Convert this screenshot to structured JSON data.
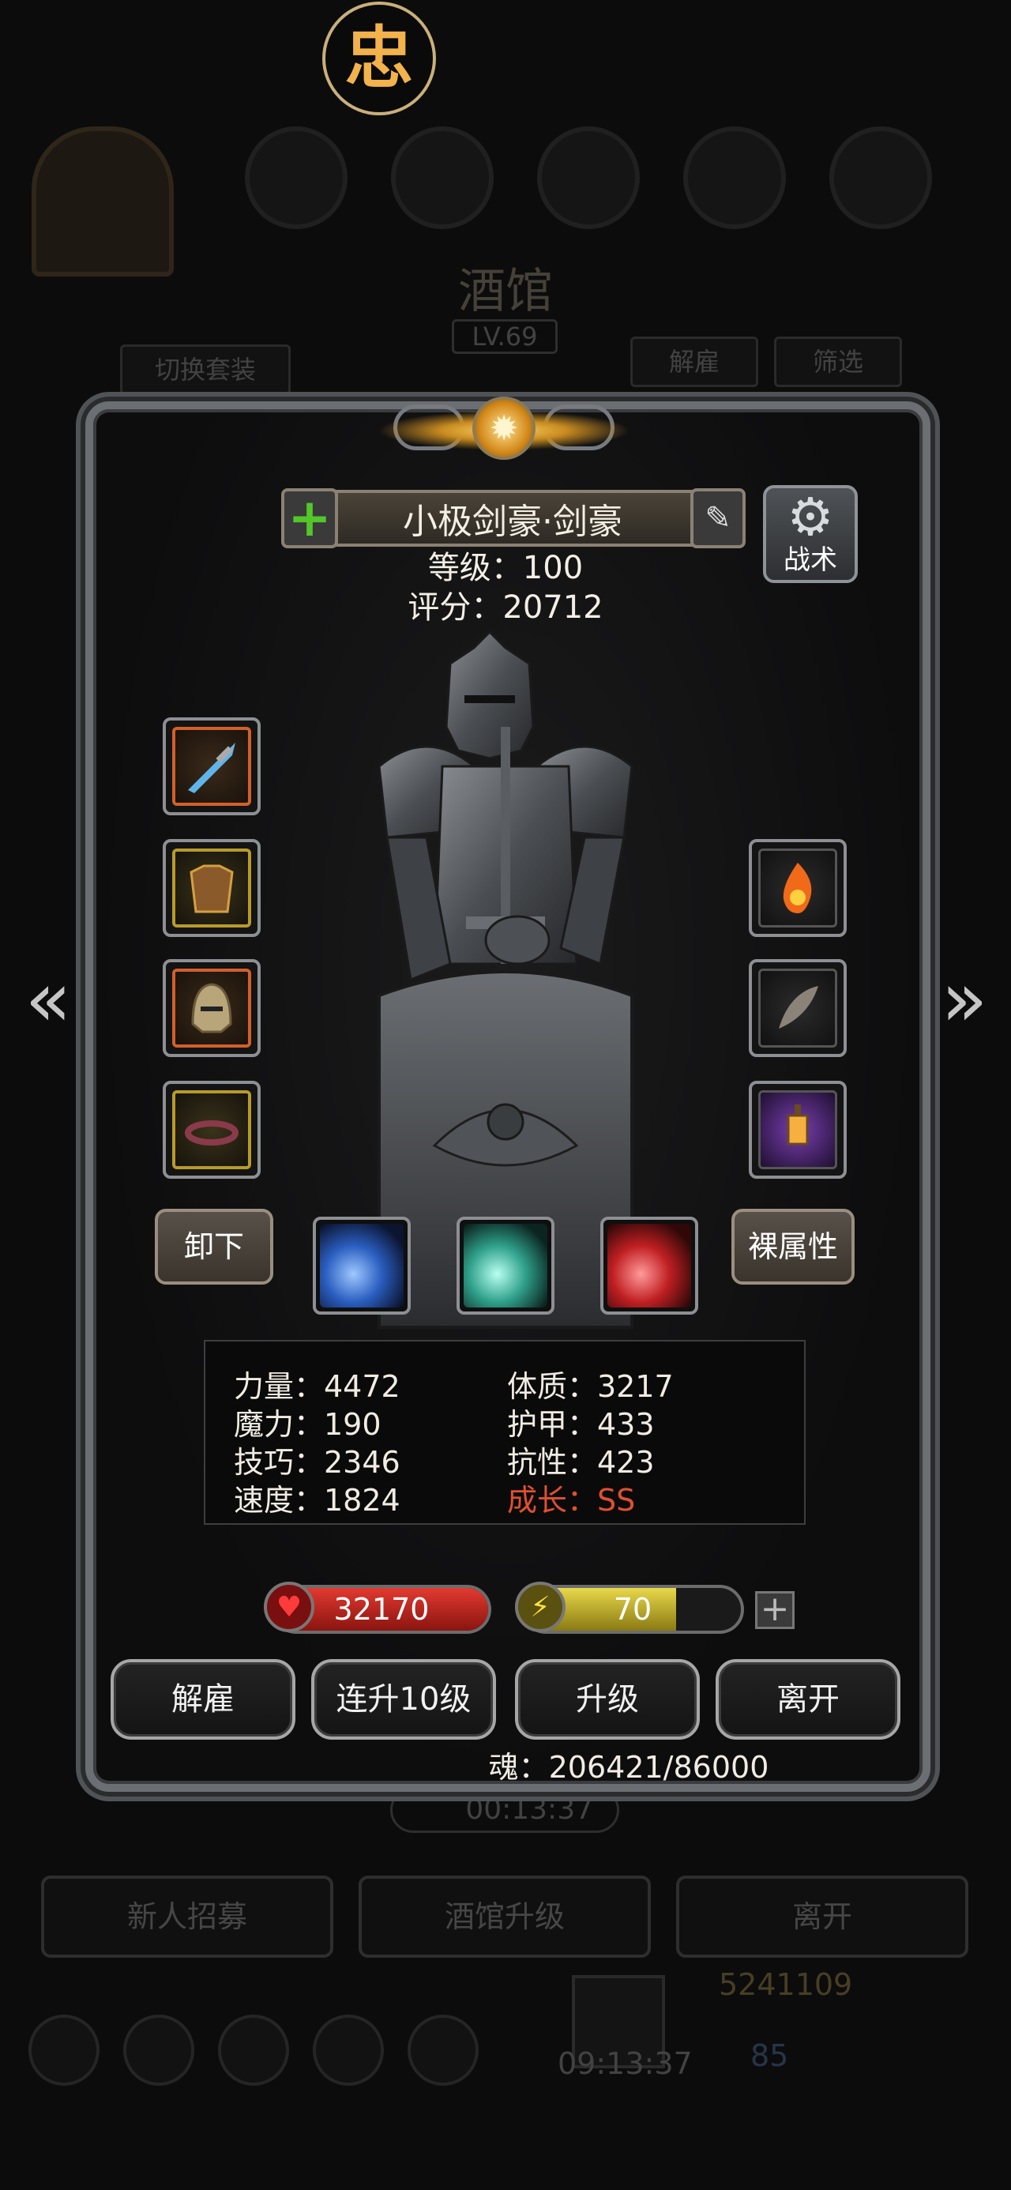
{
  "background": {
    "title": "酒馆",
    "level": "LV.69",
    "switch_set_label": "切换套装",
    "dismiss_label": "解雇",
    "filter_label": "筛选",
    "timer": "00:13:37",
    "recruit_label": "新人招募",
    "upgrade_tavern_label": "酒馆升级",
    "leave_label": "离开",
    "gold": "5241109",
    "gems": "85",
    "bottom_time": "09:13:37"
  },
  "hero": {
    "name": "小极剑豪·剑豪",
    "level_line": "等级：100",
    "score_line": "评分：20712",
    "tactics_label": "战术"
  },
  "equip_buttons": {
    "unequip_label": "卸下",
    "base_attrs_label": "裸属性"
  },
  "attributes": {
    "strength": "力量：4472",
    "magic": "魔力：190",
    "skill": "技巧：2346",
    "speed": "速度：1824",
    "constitution": "体质：3217",
    "armor": "护甲：433",
    "resistance": "抗性：423",
    "growth": "成长：SS"
  },
  "bars": {
    "hp_text": "32170",
    "hp_fraction": 1.0,
    "energy_text": "70",
    "energy_fraction": 0.7
  },
  "actions": {
    "dismiss_label": "解雇",
    "level10_label": "连升10级",
    "upgrade_label": "升级",
    "leave_label": "离开"
  },
  "soul_line": "魂：206421/86000",
  "logo_glyph": "忠",
  "colors": {
    "hp": "#c8201c",
    "energy": "#c9b62a",
    "growth": "#e05030",
    "plus": "#53c62a"
  }
}
